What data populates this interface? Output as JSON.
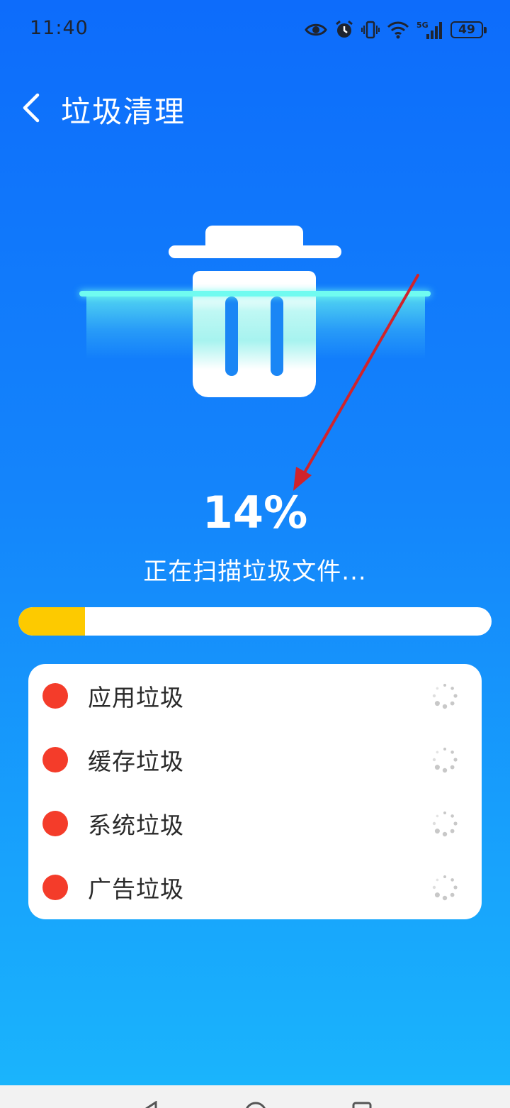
{
  "status_bar": {
    "time": "11:40",
    "battery": "49",
    "icons": [
      "eye-icon",
      "alarm-icon",
      "vibrate-icon",
      "wifi-icon",
      "signal-5g-icon",
      "battery-icon"
    ]
  },
  "header": {
    "back_icon": "chevron-left-icon",
    "title": "垃圾清理"
  },
  "scan": {
    "icon": "trash-can-icon",
    "percent": "14%",
    "progress": 0.14,
    "status_text": "正在扫描垃圾文件..."
  },
  "categories": [
    {
      "label": "应用垃圾"
    },
    {
      "label": "缓存垃圾"
    },
    {
      "label": "系统垃圾"
    },
    {
      "label": "广告垃圾"
    }
  ],
  "colors": {
    "background_top": "#0d6cfb",
    "background_bottom": "#1ab6fc",
    "progress_fill": "#fdca00",
    "category_dot": "#f43c2a",
    "scan_glow": "#70fbf0",
    "annotation_arrow": "#d0232b"
  },
  "nav_bar": {
    "icons": [
      "back-triangle-icon",
      "home-circle-icon",
      "recents-square-icon"
    ]
  }
}
